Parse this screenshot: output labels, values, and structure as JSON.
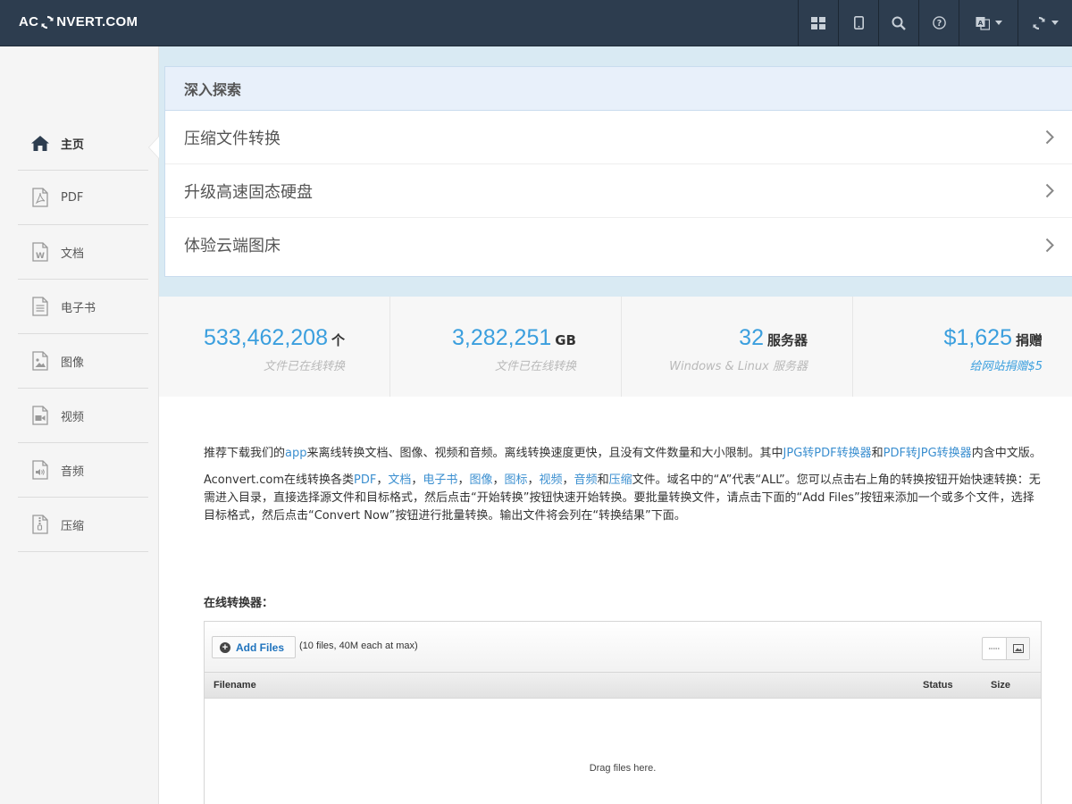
{
  "header": {
    "logo_left": "AC",
    "logo_right": "NVERT.COM",
    "nav_icons": [
      "apps-grid-icon",
      "tablet-icon",
      "search-icon",
      "help-icon",
      "language-icon",
      "convert-refresh-icon"
    ]
  },
  "sidebar": {
    "items": [
      {
        "label": "主页",
        "icon": "home-icon"
      },
      {
        "label": "PDF",
        "icon": "pdf-file-icon"
      },
      {
        "label": "文档",
        "icon": "word-file-icon"
      },
      {
        "label": "电子书",
        "icon": "ebook-file-icon"
      },
      {
        "label": "图像",
        "icon": "image-file-icon"
      },
      {
        "label": "视频",
        "icon": "video-file-icon"
      },
      {
        "label": "音频",
        "icon": "audio-file-icon"
      },
      {
        "label": "压缩",
        "icon": "archive-file-icon"
      }
    ]
  },
  "explore": {
    "title": "深入探索",
    "rows": [
      "压缩文件转换",
      "升级高速固态硬盘",
      "体验云端图床"
    ]
  },
  "stats": [
    {
      "number": "533,462,208",
      "unit": "个",
      "sub": "文件已在线转换"
    },
    {
      "number": "3,282,251",
      "unit": "GB",
      "sub": "文件已在线转换"
    },
    {
      "number": "32",
      "unit": "服务器",
      "sub": "Windows & Linux 服务器"
    },
    {
      "number": "$1,625",
      "unit": "捐赠",
      "sub": "给网站捐赠$5"
    }
  ],
  "content": {
    "p1": {
      "t1": "推荐下载我们的",
      "l1": "app",
      "t2": "来离线转换文档、图像、视频和音频。离线转换速度更快，且没有文件数量和大小限制。其中",
      "l2": "JPG转PDF转换器",
      "t3": "和",
      "l3": "PDF转JPG转换器",
      "t4": "内含中文版。"
    },
    "p2": {
      "t1": "Aconvert.com在线转换各类",
      "l1": "PDF",
      "s1": "，",
      "l2": "文档",
      "s2": "，",
      "l3": "电子书",
      "s3": "，",
      "l4": "图像",
      "s4": "，",
      "l5": "图标",
      "s5": "，",
      "l6": "视频",
      "s6": "，",
      "l7": "音频",
      "s7": "和",
      "l8": "压缩",
      "t2": "文件。域名中的“A”代表“ALL”。您可以点击右上角的转换按钮开始快速转换：无需进入目录，直接选择源文件和目标格式，然后点击“开始转换”按钮快速开始转换。要批量转换文件，请点击下面的“Add Files”按钮来添加一个或多个文件，选择目标格式，然后点击“Convert Now”按钮进行批量转换。输出文件将会列在“转换结果”下面。"
    },
    "converter_title": "在线转换器："
  },
  "converter": {
    "add_files": "Add Files",
    "hint": "(10 files, 40M each at max)",
    "columns": {
      "filename": "Filename",
      "status": "Status",
      "size": "Size"
    },
    "drop_text": "Drag files here."
  }
}
